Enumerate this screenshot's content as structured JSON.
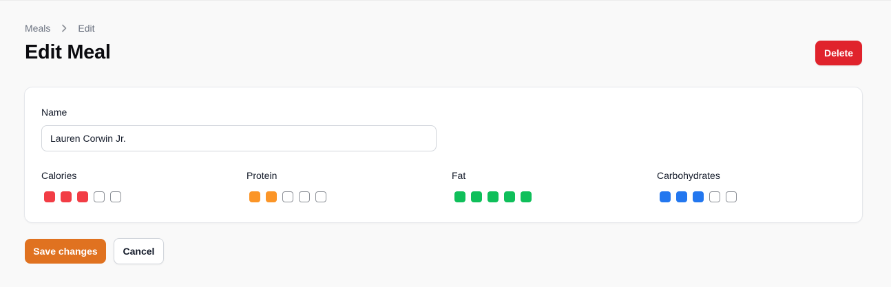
{
  "breadcrumb": {
    "items": [
      "Meals",
      "Edit"
    ]
  },
  "page": {
    "title": "Edit Meal"
  },
  "actions": {
    "delete_label": "Delete",
    "save_label": "Save changes",
    "cancel_label": "Cancel"
  },
  "form": {
    "name_label": "Name",
    "name_value": "Lauren Corwin Jr.",
    "metrics": [
      {
        "label": "Calories",
        "value": 3,
        "max": 5,
        "color": "#f23d45"
      },
      {
        "label": "Protein",
        "value": 2,
        "max": 5,
        "color": "#fb9527"
      },
      {
        "label": "Fat",
        "value": 5,
        "max": 5,
        "color": "#0fbf5a"
      },
      {
        "label": "Carbohydrates",
        "value": 3,
        "max": 5,
        "color": "#2377ef"
      }
    ]
  },
  "colors": {
    "delete": "#e0232c",
    "save": "#e07220"
  },
  "icons": {
    "breadcrumb_separator": "chevron-right-icon"
  }
}
